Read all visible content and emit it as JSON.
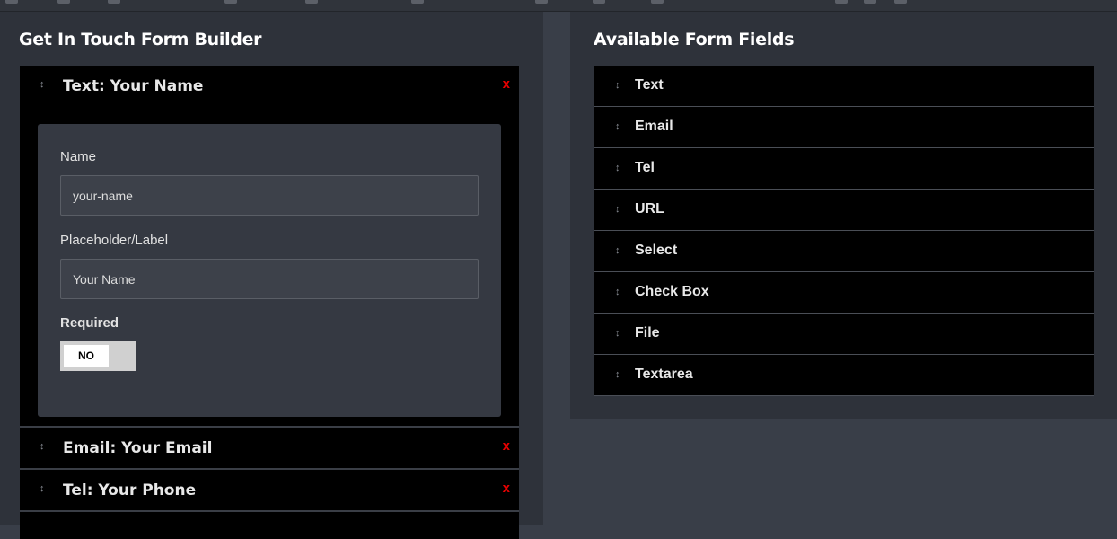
{
  "builder": {
    "title": "Get In Touch Form Builder",
    "remove_label": "x",
    "drag_glyph": "↕",
    "expanded_field": {
      "title": "Text: Your Name",
      "name_label": "Name",
      "name_value": "your-name",
      "placeholder_label": "Placeholder/Label",
      "placeholder_value": "Your Name",
      "required_label": "Required",
      "required_value": "NO"
    },
    "collapsed_fields": [
      {
        "title": "Email: Your Email"
      },
      {
        "title": "Tel: Your Phone"
      }
    ]
  },
  "available": {
    "title": "Available Form Fields",
    "items": [
      {
        "label": "Text"
      },
      {
        "label": "Email"
      },
      {
        "label": "Tel"
      },
      {
        "label": "URL"
      },
      {
        "label": "Select"
      },
      {
        "label": "Check Box"
      },
      {
        "label": "File"
      },
      {
        "label": "Textarea"
      }
    ]
  },
  "colors": {
    "page_bg": "#393e48",
    "panel_bg": "#2e323a",
    "item_bg": "#000000",
    "remove_red": "#e60000"
  }
}
